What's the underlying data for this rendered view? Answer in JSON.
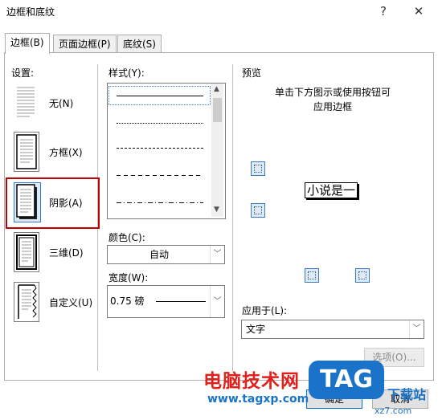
{
  "window": {
    "title": "边框和底纹",
    "help": "?",
    "close": "✕"
  },
  "tabs": [
    {
      "label": "边框(B)"
    },
    {
      "label": "页面边框(P)"
    },
    {
      "label": "底纹(S)"
    }
  ],
  "settings": {
    "header": "设置:",
    "items": [
      {
        "label": "无(N)"
      },
      {
        "label": "方框(X)"
      },
      {
        "label": "阴影(A)"
      },
      {
        "label": "三维(D)"
      },
      {
        "label": "自定义(U)"
      }
    ]
  },
  "style": {
    "header": "样式(Y):",
    "line_styles": [
      "solid",
      "dotted",
      "dashed-fine",
      "dashed",
      "dash-dot"
    ]
  },
  "color": {
    "header": "颜色(C):",
    "value": "自动"
  },
  "width": {
    "header": "宽度(W):",
    "value": "0.75 磅"
  },
  "preview": {
    "header": "预览",
    "instruction_line1": "单击下方图示或使用按钮可",
    "instruction_line2": "应用边框",
    "sample_text": "小说是一",
    "apply_to_label": "应用于(L):",
    "apply_to_value": "文字",
    "options_button": "选项(O)..."
  },
  "footer": {
    "ok": "确定",
    "cancel": "取消"
  },
  "watermark": {
    "site_name": "电脑技术网",
    "url": "www.tagxp.com",
    "logo_text": "TAG",
    "logo_sub": "下载站",
    "logo_sub_url": "xz7.com"
  },
  "colors": {
    "highlight_border": "#c00000",
    "watermark_red": "#e2201c",
    "watermark_blue": "#1a73c8"
  }
}
